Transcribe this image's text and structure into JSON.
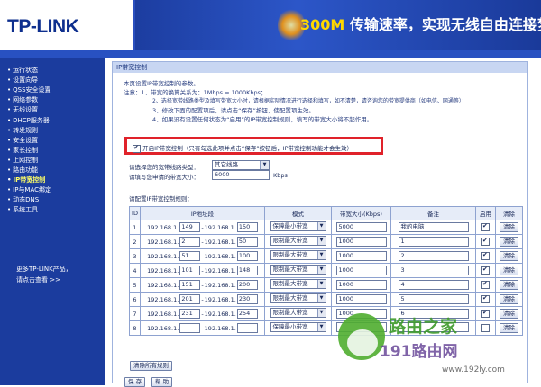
{
  "header": {
    "logo": "TP-LINK",
    "banner_highlight": "300M",
    "banner_text": "传输速率，实现无线自由连接梦想"
  },
  "sidebar": {
    "items": [
      {
        "label": "运行状态",
        "active": false
      },
      {
        "label": "设置向导",
        "active": false
      },
      {
        "label": "QSS安全设置",
        "active": false
      },
      {
        "label": "网络参数",
        "active": false
      },
      {
        "label": "无线设置",
        "active": false
      },
      {
        "label": "DHCP服务器",
        "active": false
      },
      {
        "label": "转发规则",
        "active": false
      },
      {
        "label": "安全设置",
        "active": false
      },
      {
        "label": "家长控制",
        "active": false
      },
      {
        "label": "上网控制",
        "active": false
      },
      {
        "label": "路由功能",
        "active": false
      },
      {
        "label": "IP带宽控制",
        "active": true
      },
      {
        "label": "IP与MAC绑定",
        "active": false
      },
      {
        "label": "动态DNS",
        "active": false
      },
      {
        "label": "系统工具",
        "active": false
      }
    ],
    "more_line1": "更多TP-LINK产品，",
    "more_line2": "请点击查看 >>"
  },
  "panel": {
    "title": "IP带宽控制",
    "intro": "本页设置IP带宽控制的参数。",
    "note1": "注意：1、带宽的换算关系为：1Mbps = 1000Kbps；",
    "note2": "2、选择宽带线路类型及填写带宽大小时，请根据实际情况进行选择和填写，如不清楚，请咨询您的带宽提供商（如电信、网通等）；",
    "note3": "3、修改下面的配置项后，请点击“保存”按钮，使配置项生效。",
    "note4": "4、如果没有设置任何状态为“启用”的IP带宽控制规则，填写的带宽大小将不起作用。",
    "enable_label": "开启IP带宽控制（只有勾选此项并点击“保存”按钮后，IP带宽控制功能才会生效）",
    "enable_checked": true,
    "line_type_label": "请选择您的宽带线路类型：",
    "line_type_value": "其它线路",
    "total_bw_label": "请填写您申请的带宽大小：",
    "total_bw_value": "6000",
    "unit": "Kbps",
    "rules_caption": "请配置IP带宽控制规则：",
    "clear_all": "清除所有规则",
    "save": "保 存",
    "help": "帮 助"
  },
  "table": {
    "headers": [
      "ID",
      "IP地址段",
      "模式",
      "带宽大小(Kbps)",
      "备注",
      "启用",
      "清除"
    ],
    "rows": [
      {
        "id": "1",
        "ip_prefix": "192.168.1.",
        "start": "149",
        "sep": "-",
        "end_prefix": "192.168.1.",
        "end": "150",
        "mode": "保障最小带宽",
        "bw": "5000",
        "note": "我的电脑",
        "enabled": true,
        "clear": "清除"
      },
      {
        "id": "2",
        "ip_prefix": "192.168.1.",
        "start": "2",
        "sep": "-",
        "end_prefix": "192.168.1.",
        "end": "50",
        "mode": "限制最大带宽",
        "bw": "1000",
        "note": "1",
        "enabled": true,
        "clear": "清除"
      },
      {
        "id": "3",
        "ip_prefix": "192.168.1.",
        "start": "51",
        "sep": "-",
        "end_prefix": "192.168.1.",
        "end": "100",
        "mode": "限制最大带宽",
        "bw": "1000",
        "note": "2",
        "enabled": true,
        "clear": "清除"
      },
      {
        "id": "4",
        "ip_prefix": "192.168.1.",
        "start": "101",
        "sep": "-",
        "end_prefix": "192.168.1.",
        "end": "148",
        "mode": "限制最大带宽",
        "bw": "1000",
        "note": "3",
        "enabled": true,
        "clear": "清除"
      },
      {
        "id": "5",
        "ip_prefix": "192.168.1.",
        "start": "151",
        "sep": "-",
        "end_prefix": "192.168.1.",
        "end": "200",
        "mode": "限制最大带宽",
        "bw": "1000",
        "note": "4",
        "enabled": true,
        "clear": "清除"
      },
      {
        "id": "6",
        "ip_prefix": "192.168.1.",
        "start": "201",
        "sep": "-",
        "end_prefix": "192.168.1.",
        "end": "230",
        "mode": "限制最大带宽",
        "bw": "1000",
        "note": "5",
        "enabled": true,
        "clear": "清除"
      },
      {
        "id": "7",
        "ip_prefix": "192.168.1.",
        "start": "231",
        "sep": "-",
        "end_prefix": "192.168.1.",
        "end": "254",
        "mode": "限制最大带宽",
        "bw": "1000",
        "note": "6",
        "enabled": true,
        "clear": "清除"
      },
      {
        "id": "8",
        "ip_prefix": "192.168.1.",
        "start": "",
        "sep": "-",
        "end_prefix": "192.168.1.",
        "end": "",
        "mode": "保障最小带宽",
        "bw": "",
        "note": "",
        "enabled": false,
        "clear": "清除"
      }
    ]
  },
  "watermark": {
    "name": "路由之家",
    "site": "191路由网",
    "url": "www.192ly.com"
  },
  "colors": {
    "header_blue": "#1c3d99",
    "sidebar_blue": "#1b3c9e",
    "highlight_red": "#e0222a",
    "banner_yellow": "#ffd800",
    "watermark_green": "#3d9a2a"
  }
}
